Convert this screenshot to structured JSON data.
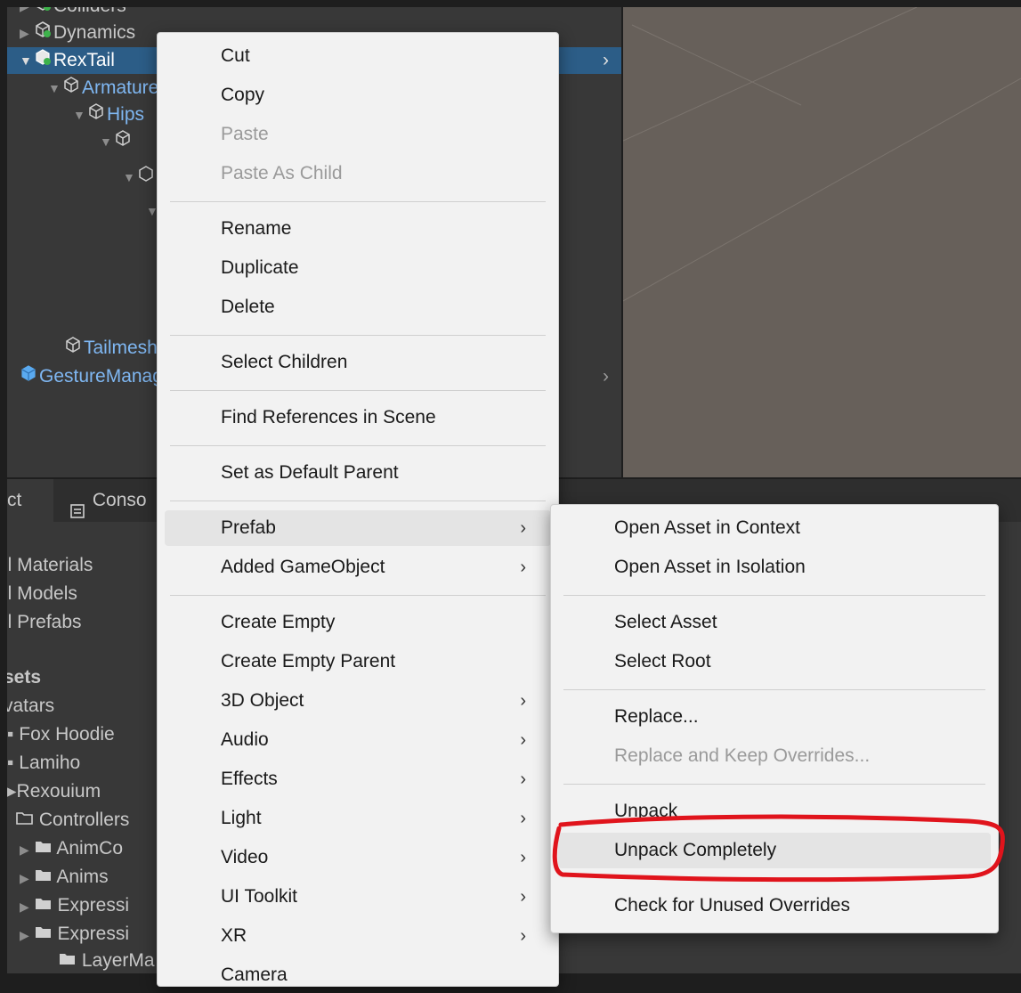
{
  "hierarchy": {
    "items": [
      {
        "label": "Colliders"
      },
      {
        "label": "Dynamics"
      },
      {
        "label": "RexTail"
      },
      {
        "label": "Armature"
      },
      {
        "label": "Hips"
      },
      {
        "label": "Tailmesh"
      },
      {
        "label": "GestureManager"
      }
    ],
    "chevron": "›"
  },
  "project": {
    "tabs": [
      {
        "label": "ct"
      },
      {
        "label": "Conso"
      }
    ],
    "items": [
      {
        "label": "ll Materials"
      },
      {
        "label": "ll Models"
      },
      {
        "label": "ll Prefabs"
      },
      {
        "label": "sets"
      },
      {
        "label": "vatars"
      },
      {
        "label": "Fox Hoodie"
      },
      {
        "label": "Lamiho"
      },
      {
        "label": "Rexouium"
      },
      {
        "label": "Controllers"
      },
      {
        "label": "AnimCo"
      },
      {
        "label": "Anims"
      },
      {
        "label": "Expressi"
      },
      {
        "label": "Expressi"
      },
      {
        "label": "LayerMa"
      }
    ]
  },
  "context_menu": {
    "items": [
      {
        "label": "Cut"
      },
      {
        "label": "Copy"
      },
      {
        "label": "Paste"
      },
      {
        "label": "Paste As Child"
      },
      {
        "label": "Rename"
      },
      {
        "label": "Duplicate"
      },
      {
        "label": "Delete"
      },
      {
        "label": "Select Children"
      },
      {
        "label": "Find References in Scene"
      },
      {
        "label": "Set as Default Parent"
      },
      {
        "label": "Prefab"
      },
      {
        "label": "Added GameObject"
      },
      {
        "label": "Create Empty"
      },
      {
        "label": "Create Empty Parent"
      },
      {
        "label": "3D Object"
      },
      {
        "label": "Audio"
      },
      {
        "label": "Effects"
      },
      {
        "label": "Light"
      },
      {
        "label": "Video"
      },
      {
        "label": "UI Toolkit"
      },
      {
        "label": "XR"
      },
      {
        "label": "Camera"
      }
    ],
    "submenu_arrow": "›"
  },
  "prefab_menu": {
    "items": [
      {
        "label": "Open Asset in Context"
      },
      {
        "label": "Open Asset in Isolation"
      },
      {
        "label": "Select Asset"
      },
      {
        "label": "Select Root"
      },
      {
        "label": "Replace..."
      },
      {
        "label": "Replace and Keep Overrides..."
      },
      {
        "label": "Unpack"
      },
      {
        "label": "Unpack Completely"
      },
      {
        "label": "Check for Unused Overrides"
      }
    ]
  },
  "colors": {
    "selection": "#2c5d87",
    "menu_bg": "#f2f2f2",
    "highlight_annotation": "#e0141c",
    "prefab_blue": "#7fb7f2"
  },
  "icons": {
    "prefab": "prefab-cube-icon",
    "gameobject": "gameobject-cube-icon",
    "folder": "folder-icon",
    "console": "console-icon"
  }
}
